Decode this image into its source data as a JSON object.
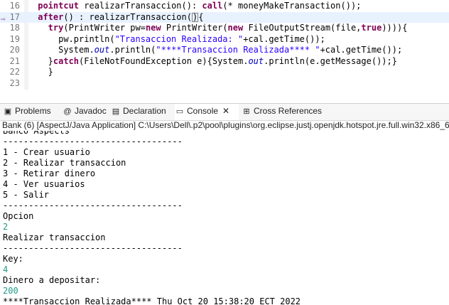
{
  "editor": {
    "lines": [
      {
        "num": "16",
        "parts": [
          [
            "kw",
            "pointcut "
          ],
          [
            "",
            "realizarTransaccion(): "
          ],
          [
            "kw",
            "call"
          ],
          [
            "",
            "(* moneyMakeTransaction());"
          ]
        ]
      },
      {
        "num": "17",
        "current": true,
        "marker": "⇨",
        "parts": [
          [
            "kw",
            "after"
          ],
          [
            "",
            "() : realizarTransaccion("
          ],
          [
            "cursor",
            ")"
          ],
          [
            "",
            "{"
          ]
        ]
      },
      {
        "num": "18",
        "parts": [
          [
            "kw",
            "try"
          ],
          [
            "",
            "(PrintWriter pw="
          ],
          [
            "kw",
            "new "
          ],
          [
            "",
            "PrintWriter("
          ],
          [
            "kw",
            "new "
          ],
          [
            "",
            "FileOutputStream(file,"
          ],
          [
            "kw",
            "true"
          ],
          [
            "",
            ")))){"
          ]
        ]
      },
      {
        "num": "19",
        "parts": [
          [
            "",
            "pw.println("
          ],
          [
            "str",
            "\"Transaccion Realizada: \""
          ],
          [
            "",
            "+cal.getTime());"
          ]
        ]
      },
      {
        "num": "20",
        "parts": [
          [
            "",
            "System."
          ],
          [
            "fld",
            "out"
          ],
          [
            "",
            ".println("
          ],
          [
            "str",
            "\"****Transaccion Realizada**** \""
          ],
          [
            "",
            "+cal.getTime());"
          ]
        ]
      },
      {
        "num": "21",
        "parts": [
          [
            "",
            "}"
          ],
          [
            "kw",
            "catch"
          ],
          [
            "",
            "(FileNotFoundException e){System."
          ],
          [
            "fld",
            "out"
          ],
          [
            "",
            ".println(e.getMessage());}"
          ]
        ]
      },
      {
        "num": "22",
        "parts": [
          [
            "",
            "}"
          ]
        ]
      },
      {
        "num": "23",
        "parts": []
      }
    ]
  },
  "tabs": {
    "problems": "Problems",
    "javadoc": "Javadoc",
    "declaration": "Declaration",
    "console": "Console",
    "cross_references": "Cross References"
  },
  "console_path": "Bank (6) [AspectJ/Java Application] C:\\Users\\Dell\\.p2\\pool\\plugins\\org.eclipse.justj.openjdk.hotspot.jre.full.win32.x86_6",
  "console_lines": [
    {
      "text": "Banco Aspects"
    },
    {
      "text": "-----------------------------------"
    },
    {
      "text": "1 - Crear usuario"
    },
    {
      "text": "2 - Realizar transaccion"
    },
    {
      "text": "3 - Retirar dinero"
    },
    {
      "text": "4 - Ver usuarios"
    },
    {
      "text": "5 - Salir"
    },
    {
      "text": "-----------------------------------"
    },
    {
      "text": "Opcion"
    },
    {
      "text": "2",
      "input": true
    },
    {
      "text": "Realizar transaccion"
    },
    {
      "text": "-----------------------------------"
    },
    {
      "text": "Key:"
    },
    {
      "text": "4",
      "input": true
    },
    {
      "text": "Dinero a depositar:"
    },
    {
      "text": "200",
      "input": true
    },
    {
      "text": "****Transaccion Realizada**** Thu Oct 20 15:38:20 ECT 2022"
    }
  ]
}
